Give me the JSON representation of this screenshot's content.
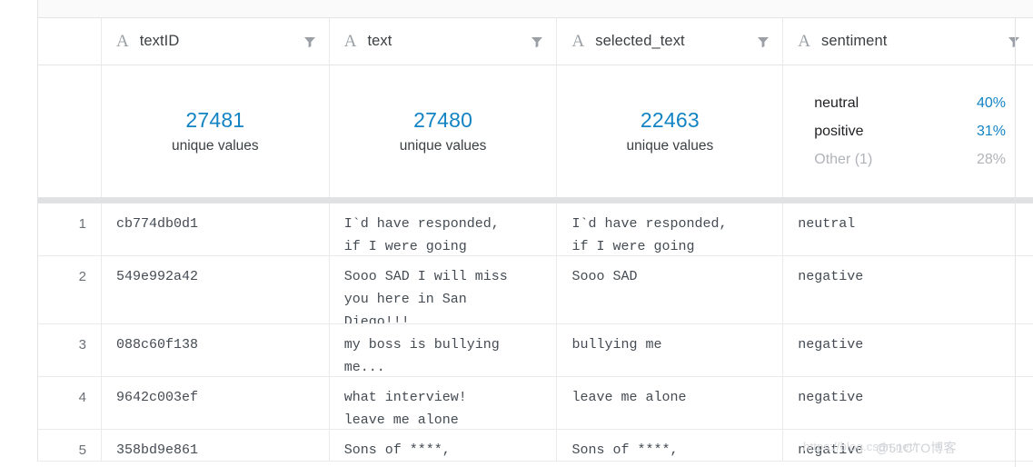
{
  "table": {
    "columns": [
      {
        "name": "textID",
        "type_icon": "text-type-icon",
        "filter_icon": "filter-icon"
      },
      {
        "name": "text",
        "type_icon": "text-type-icon",
        "filter_icon": "filter-icon"
      },
      {
        "name": "selected_text",
        "type_icon": "text-type-icon",
        "filter_icon": "filter-icon"
      },
      {
        "name": "sentiment",
        "type_icon": "text-type-icon",
        "filter_icon": "filter-icon"
      }
    ],
    "type_glyph": "A",
    "summary": {
      "textID": {
        "value": "27481",
        "label": "unique values"
      },
      "text": {
        "value": "27480",
        "label": "unique values"
      },
      "selected_text": {
        "value": "22463",
        "label": "unique values"
      },
      "sentiment": {
        "distribution": [
          {
            "label": "neutral",
            "percent": "40%",
            "muted": false
          },
          {
            "label": "positive",
            "percent": "31%",
            "muted": false
          },
          {
            "label": "Other (1)",
            "percent": "28%",
            "muted": true
          }
        ]
      }
    },
    "rows": [
      {
        "index": "1",
        "textID": "cb774db0d1",
        "text": "I`d have responded,\nif I were going",
        "selected_text": "I`d have responded,\nif I were going",
        "sentiment": "neutral"
      },
      {
        "index": "2",
        "textID": "549e992a42",
        "text": "Sooo SAD I will miss\nyou here in San\nDiego!!!",
        "selected_text": "Sooo SAD",
        "sentiment": "negative"
      },
      {
        "index": "3",
        "textID": "088c60f138",
        "text": "my boss is bullying\nme...",
        "selected_text": "bullying me",
        "sentiment": "negative"
      },
      {
        "index": "4",
        "textID": "9642c003ef",
        "text": "what interview!\nleave me alone",
        "selected_text": "leave me alone",
        "sentiment": "negative"
      },
      {
        "index": "5",
        "textID": "358bd9e861",
        "text": "Sons of ****,",
        "selected_text": "Sons of ****,",
        "sentiment": "negative"
      }
    ]
  },
  "colors": {
    "accent_blue": "#1283c3",
    "muted_grey": "#b0b3b8",
    "grid_line": "#e9eaeb",
    "separator": "#dfe1e3"
  },
  "watermark": {
    "url": "https://blog.csdn.net/",
    "overlay": "@51CTO博客"
  }
}
